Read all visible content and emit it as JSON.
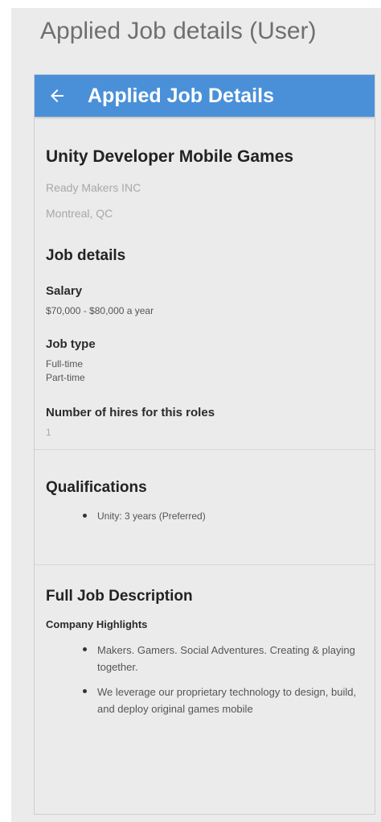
{
  "caption": "Applied Job details (User)",
  "app_bar": {
    "back_icon": "arrow-left-icon",
    "title": "Applied Job Details"
  },
  "job": {
    "title": "Unity Developer Mobile Games",
    "company": "Ready Makers INC",
    "location": "Montreal, QC"
  },
  "job_details": {
    "heading": "Job details",
    "salary_label": "Salary",
    "salary_value": "$70,000 - $80,000 a year",
    "job_type_label": "Job type",
    "job_types": [
      "Full-time",
      "Part-time"
    ],
    "hires_label": "Number of hires for this roles",
    "hires_value": "1"
  },
  "qualifications": {
    "heading": "Qualifications",
    "items": [
      "Unity: 3 years (Preferred)"
    ]
  },
  "description": {
    "heading": "Full Job Description",
    "subheading": "Company Highlights",
    "items": [
      "Makers. Gamers. Social Adventures. Creating & playing together.",
      "We leverage our proprietary technology to design, build, and deploy original games mobile"
    ]
  },
  "colors": {
    "app_bar": "#4a90d9",
    "background": "#ebebeb",
    "muted_text": "#a8a8a8"
  }
}
